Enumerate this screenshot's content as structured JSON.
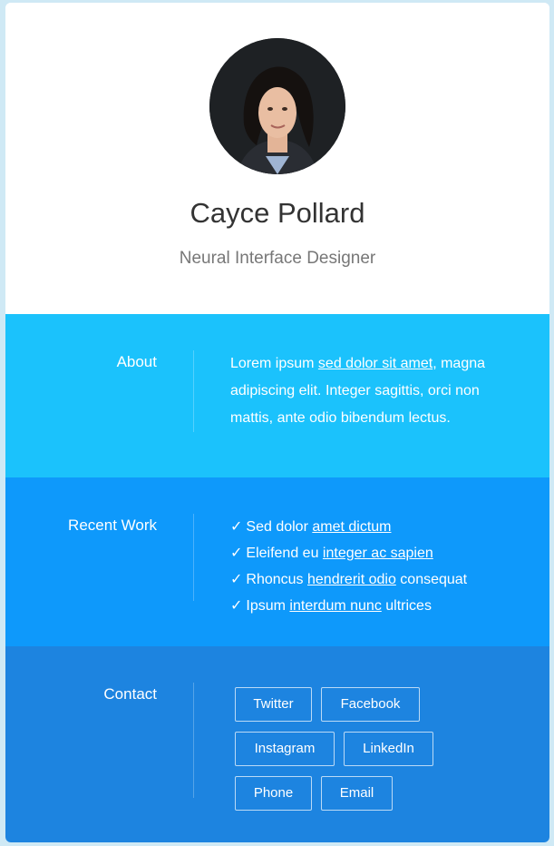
{
  "profile": {
    "name": "Cayce Pollard",
    "role": "Neural Interface Designer"
  },
  "about": {
    "label": "About",
    "text_before": "Lorem ipsum ",
    "link": "sed dolor sit amet",
    "text_after": ", magna adipiscing elit. Integer sagittis, orci non mattis, ante odio bibendum lectus."
  },
  "recent_work": {
    "label": "Recent Work",
    "check_glyph": "✓",
    "items": [
      {
        "before": "Sed dolor ",
        "link": "amet dictum",
        "after": ""
      },
      {
        "before": "Eleifend eu ",
        "link": "integer ac sapien",
        "after": ""
      },
      {
        "before": "Rhoncus ",
        "link": "hendrerit odio",
        "after": " consequat"
      },
      {
        "before": "Ipsum ",
        "link": "interdum nunc",
        "after": " ultrices"
      }
    ]
  },
  "contact": {
    "label": "Contact",
    "buttons": [
      "Twitter",
      "Facebook",
      "Instagram",
      "LinkedIn",
      "Phone",
      "Email"
    ]
  },
  "colors": {
    "about_bg": "#1bc2fc",
    "work_bg": "#0e99fb",
    "contact_bg": "#1d84e0"
  }
}
